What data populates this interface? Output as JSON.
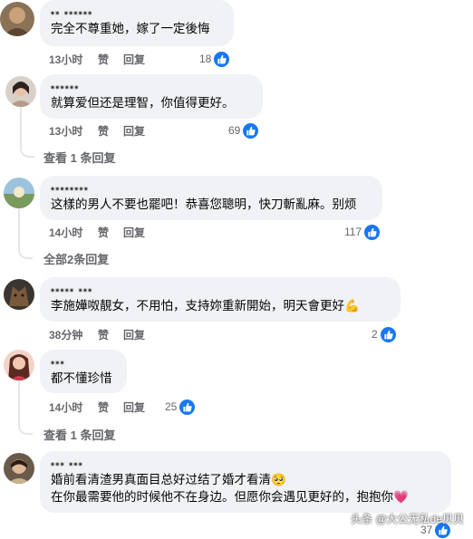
{
  "comments": [
    {
      "author": "▪▪ ▪▪▪▪▪▪",
      "text": [
        "完全不尊重她，嫁了一定後悔"
      ],
      "time": "13小时",
      "like_label": "赞",
      "reply_label": "回复",
      "likes": "18"
    },
    {
      "author": "▪▪▪▪▪▪",
      "text": [
        "就算爱但还是理智，你值得更好。"
      ],
      "time": "13小时",
      "like_label": "赞",
      "reply_label": "回复",
      "likes": "69",
      "view_replies": "查看 1 条回复"
    },
    {
      "author": "▪▪▪▪▪▪▪▪",
      "text": [
        "这樣的男人不要也罷吧！恭喜您聰明，快刀斬亂麻。别烦"
      ],
      "time": "14小时",
      "like_label": "赞",
      "reply_label": "回复",
      "likes": "117",
      "view_replies": "全部2条回复"
    },
    {
      "author": "▪▪▪▪▪ ▪▪▪",
      "text": [
        "李施嬅呶靚女，不用怕，支持妳重新開始，明天會更好"
      ],
      "emoji": "💪",
      "time": "38分钟",
      "like_label": "赞",
      "reply_label": "回复",
      "likes": "2"
    },
    {
      "author": "▪▪▪",
      "text": [
        "都不懂珍惜"
      ],
      "time": "14小时",
      "like_label": "赞",
      "reply_label": "回复",
      "likes": "25",
      "view_replies": "查看 1 条回复"
    },
    {
      "author": "▪▪▪ ▪▪▪",
      "text": [
        "婚前看清渣男真面目总好过结了婚才看清",
        "在你最需要他的时候他不在身边。但愿你会遇见更好的，抱抱你"
      ],
      "emoji_line1": "🥺",
      "emoji_line2": "💗",
      "likes": "37"
    }
  ],
  "watermark": "头条 @大公无私de贝贝",
  "colors": {
    "like_blue": "#1877f2",
    "bubble_bg": "#f0f2f5",
    "meta_gray": "#65676b"
  }
}
